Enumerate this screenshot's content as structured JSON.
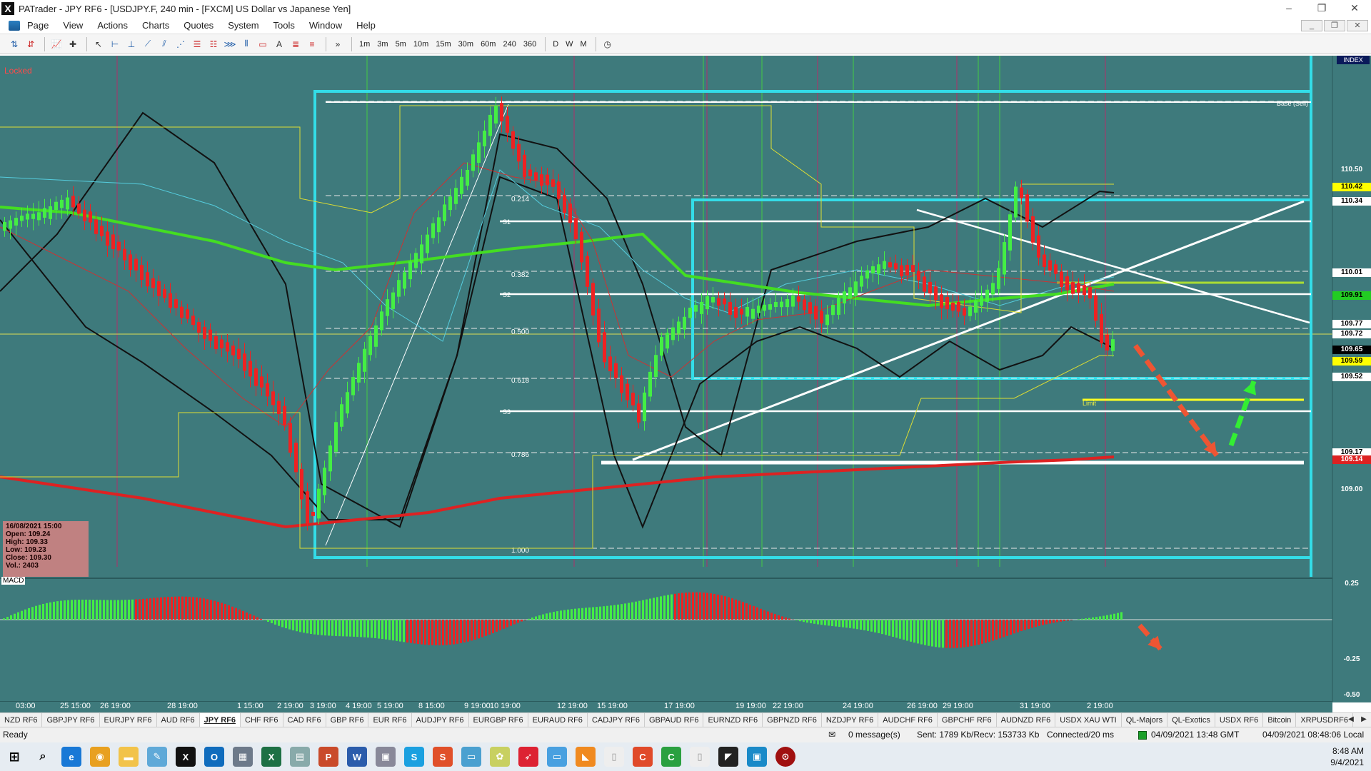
{
  "window": {
    "title": "PATrader - JPY RF6 - [USDJPY.F, 240 min - [FXCM] US Dollar vs Japanese Yen]",
    "controls": [
      "–",
      "❐",
      "✕"
    ]
  },
  "menu": {
    "items": [
      "Page",
      "View",
      "Actions",
      "Charts",
      "Quotes",
      "System",
      "Tools",
      "Window",
      "Help"
    ]
  },
  "toolbar": {
    "timeframes": [
      "1m",
      "3m",
      "5m",
      "10m",
      "15m",
      "30m",
      "60m",
      "240",
      "360",
      "D",
      "W",
      "M"
    ]
  },
  "chart": {
    "locked_label": "Locked",
    "index_label": "INDEX",
    "macd_label": "MACD",
    "fib_labels": [
      "0.214",
      "0.382",
      "0.500",
      "0.618",
      "0.786",
      "1.000"
    ],
    "pivot_labels": [
      "S1",
      "S2",
      "S3"
    ],
    "base_label": "Base (Sell)",
    "limit_label": "Limit",
    "ohlc": {
      "date": "16/08/2021 15:00",
      "open": "Open: 109.24",
      "high": "High: 109.33",
      "low": "Low: 109.23",
      "close": "Close: 109.30",
      "vol": "Vol.: 2403"
    },
    "price_labels": [
      {
        "text": "110.50",
        "bg": "",
        "fg": "#ffffff"
      },
      {
        "text": "110.42",
        "bg": "#ffff00",
        "fg": "#000000"
      },
      {
        "text": "110.34",
        "bg": "#ffffff",
        "fg": "#000000"
      },
      {
        "text": "110.01",
        "bg": "#ffffff",
        "fg": "#000000"
      },
      {
        "text": "109.91",
        "bg": "#22cc22",
        "fg": "#000000"
      },
      {
        "text": "109.77",
        "bg": "#ffffff",
        "fg": "#000000"
      },
      {
        "text": "109.72",
        "bg": "#ffffff",
        "fg": "#000000"
      },
      {
        "text": "109.65",
        "bg": "#000000",
        "fg": "#ffffff"
      },
      {
        "text": "109.59",
        "bg": "#ffff00",
        "fg": "#000000"
      },
      {
        "text": "109.52",
        "bg": "#ffffff",
        "fg": "#000000"
      },
      {
        "text": "109.17",
        "bg": "#ffffff",
        "fg": "#000000"
      },
      {
        "text": "109.14",
        "bg": "#dd2222",
        "fg": "#ffffff"
      },
      {
        "text": "109.00",
        "bg": "",
        "fg": "#ffffff"
      }
    ],
    "macd_axis": [
      "0.25",
      "-0.25",
      "-0.50"
    ],
    "time_labels": [
      "03:00",
      "25 15:00",
      "26 19:00",
      "28 19:00",
      "1 15:00",
      "2 19:00",
      "3 19:00",
      "4 19:00",
      "5 19:00",
      "8 15:00",
      "9 19:00",
      "10 19:00",
      "12 19:00",
      "15 19:00",
      "17 19:00",
      "19 19:00",
      "22 19:00",
      "24 19:00",
      "26 19:00",
      "29 19:00",
      "31 19:00",
      "2 19:00"
    ],
    "colors": {
      "background": "#3e7a7c",
      "bull": "#44ee44",
      "bear": "#ee2222",
      "frame": "#33dde8",
      "trendline": "#ffffff",
      "support": "#ffffff",
      "ma_long": "#dd2222",
      "ma_mid": "#44dd22",
      "stop": "#eeee44"
    }
  },
  "symbol_tabs": [
    "NZD RF6",
    "GBPJPY RF6",
    "EURJPY RF6",
    "AUD RF6",
    "JPY RF6",
    "CHF RF6",
    "CAD RF6",
    "GBP RF6",
    "EUR RF6",
    "AUDJPY RF6",
    "EURGBP RF6",
    "EURAUD RF6",
    "CADJPY RF6",
    "GBPAUD RF6",
    "EURNZD RF6",
    "GBPNZD RF6",
    "NZDJPY RF6",
    "AUDCHF RF6",
    "GBPCHF RF6",
    "AUDNZD RF6",
    "USDX XAU WTI",
    "QL-Majors",
    "QL-Exotics",
    "USDX RF6",
    "Bitcoin",
    "XRPUSDRF6"
  ],
  "active_tab": "JPY RF6",
  "status": {
    "ready": "Ready",
    "messages": "0 message(s)",
    "traffic": "Sent: 1789 Kb/Recv: 153733 Kb",
    "connected": "Connected/20 ms",
    "gmt_time": "04/09/2021 13:48 GMT",
    "local_time": "04/09/2021 08:48:06 Local"
  },
  "taskbar": {
    "clock_time": "8:48 AM",
    "clock_date": "9/4/2021"
  }
}
